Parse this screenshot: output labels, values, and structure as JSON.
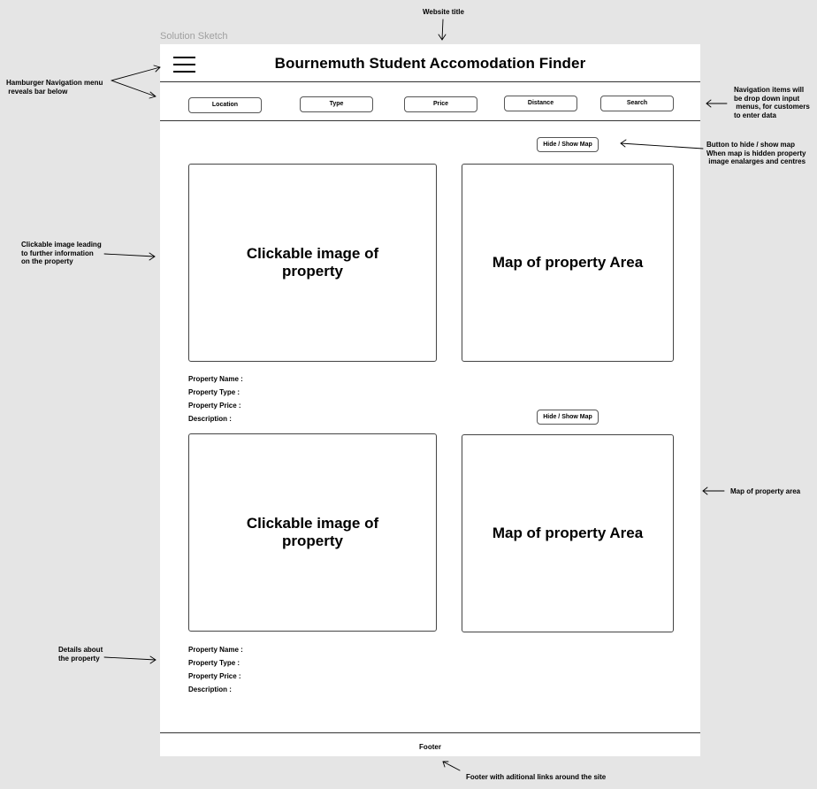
{
  "frame_label": "Solution Sketch",
  "header": {
    "site_title": "Bournemuth Student Accomodation Finder"
  },
  "nav": {
    "items": [
      {
        "label": "Location"
      },
      {
        "label": "Type"
      },
      {
        "label": "Price"
      },
      {
        "label": "Distance"
      },
      {
        "label": "Search"
      }
    ]
  },
  "listings": [
    {
      "map_toggle": "Hide / Show Map",
      "image_text": "Clickable image of property",
      "map_text": "Map of property Area",
      "details": [
        "Property Name :",
        "Property Type :",
        "Property Price :",
        "Description :"
      ]
    },
    {
      "map_toggle": "Hide / Show Map",
      "image_text": "Clickable image of property",
      "map_text": "Map of property Area",
      "details": [
        "Property Name :",
        "Property Type :",
        "Property Price :",
        "Description :"
      ]
    }
  ],
  "footer": {
    "label": "Footer"
  },
  "annotations": {
    "website_title": "Website title",
    "hamburger": [
      "Hamburger Navigation menu",
      " reveals bar below"
    ],
    "nav_items": [
      "Navigation items will",
      "be drop down input",
      " menus, for customers",
      "to enter data"
    ],
    "hide_show": [
      "Button to hide / show map",
      "When map is hidden property",
      " image enalarges and centres"
    ],
    "clickable_image": [
      "Clickable image leading",
      "to further information",
      "on the property"
    ],
    "map_area": "Map of property area",
    "details": [
      "Details about",
      "the property"
    ],
    "footer": "Footer with aditional links around the site"
  }
}
